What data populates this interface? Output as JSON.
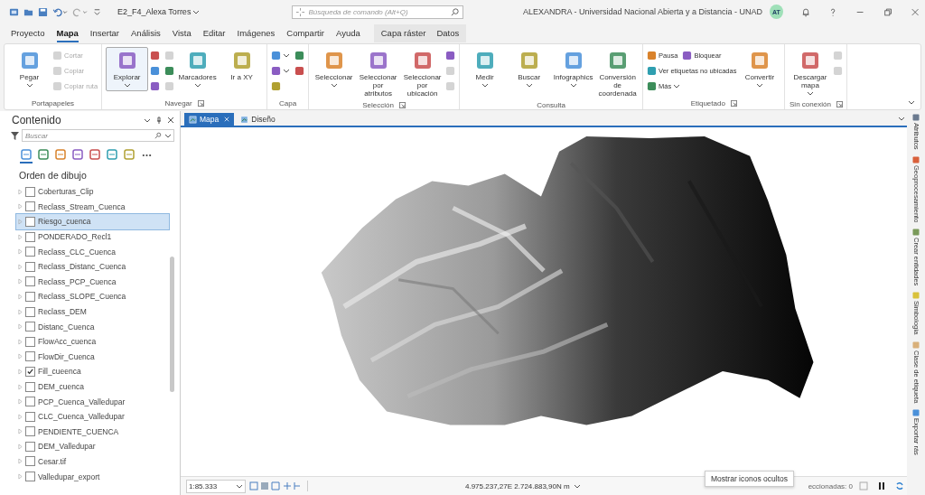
{
  "title_bar": {
    "project": "E2_F4_Alexa Torres",
    "search_placeholder": "Búsqueda de comando (Alt+Q)",
    "title": "ALEXANDRA - Universidad Nacional Abierta y a Distancia - UNAD",
    "avatar": "AT"
  },
  "menu_tabs": [
    {
      "label": "Proyecto",
      "selected": false
    },
    {
      "label": "Mapa",
      "selected": true
    },
    {
      "label": "Insertar",
      "selected": false
    },
    {
      "label": "Análisis",
      "selected": false
    },
    {
      "label": "Vista",
      "selected": false
    },
    {
      "label": "Editar",
      "selected": false
    },
    {
      "label": "Imágenes",
      "selected": false
    },
    {
      "label": "Compartir",
      "selected": false
    },
    {
      "label": "Ayuda",
      "selected": false
    }
  ],
  "contextual_tabs": [
    {
      "label": "Capa ráster",
      "selected": false
    },
    {
      "label": "Datos",
      "selected": false
    }
  ],
  "ribbon": {
    "groups": [
      {
        "label": "Portapapeles",
        "launcher": false,
        "items": [
          {
            "kind": "large",
            "label": "Pegar",
            "dropdown": true,
            "disabled": false,
            "selected": false
          },
          {
            "kind": "stack",
            "rows": [
              [
                {
                  "label": "Cortar",
                  "disabled": true,
                  "dropdown": false
                }
              ],
              [
                {
                  "label": "Copiar",
                  "disabled": true,
                  "dropdown": false
                }
              ],
              [
                {
                  "label": "Copiar ruta",
                  "disabled": true,
                  "dropdown": false
                }
              ]
            ]
          }
        ]
      },
      {
        "label": "Navegar",
        "launcher": true,
        "items": [
          {
            "kind": "large",
            "label": "Explorar",
            "dropdown": true,
            "disabled": false,
            "selected": true
          },
          {
            "kind": "stack",
            "rows": [
              [
                {
                  "disabled": false,
                  "dropdown": false
                },
                {
                  "disabled": true,
                  "dropdown": false
                }
              ],
              [
                {
                  "disabled": false,
                  "dropdown": false
                },
                {
                  "disabled": false,
                  "dropdown": false
                }
              ],
              [
                {
                  "disabled": false,
                  "dropdown": false
                },
                {
                  "disabled": true,
                  "dropdown": false
                }
              ]
            ]
          },
          {
            "kind": "large",
            "label": "Marcadores",
            "dropdown": true,
            "disabled": false,
            "selected": false
          },
          {
            "kind": "large",
            "label": "Ir a XY",
            "dropdown": false,
            "disabled": false,
            "selected": false
          }
        ]
      },
      {
        "label": "Capa",
        "launcher": false,
        "items": [
          {
            "kind": "stack",
            "rows": [
              [
                {
                  "disabled": false,
                  "dropdown": true
                },
                {
                  "disabled": false,
                  "dropdown": false
                }
              ],
              [
                {
                  "disabled": false,
                  "dropdown": true
                },
                {
                  "disabled": false,
                  "dropdown": false
                }
              ],
              [
                {
                  "disabled": false,
                  "dropdown": false
                }
              ]
            ]
          }
        ]
      },
      {
        "label": "Selección",
        "launcher": true,
        "items": [
          {
            "kind": "large",
            "label": "Seleccionar",
            "dropdown": true,
            "disabled": false,
            "selected": false
          },
          {
            "kind": "large",
            "label": "Seleccionar por atributos",
            "dropdown": false,
            "disabled": false,
            "selected": false
          },
          {
            "kind": "large",
            "label": "Seleccionar por ubicación",
            "dropdown": false,
            "disabled": false,
            "selected": false
          },
          {
            "kind": "stack",
            "rows": [
              [
                {
                  "disabled": false,
                  "dropdown": false
                }
              ],
              [
                {
                  "disabled": true,
                  "dropdown": false
                }
              ],
              [
                {
                  "disabled": true,
                  "dropdown": false
                }
              ]
            ]
          }
        ]
      },
      {
        "label": "Consulta",
        "launcher": false,
        "items": [
          {
            "kind": "large",
            "label": "Medir",
            "dropdown": true,
            "disabled": false,
            "selected": false
          },
          {
            "kind": "large",
            "label": "Buscar",
            "dropdown": true,
            "disabled": false,
            "selected": false
          },
          {
            "kind": "large",
            "label": "Infographics",
            "dropdown": true,
            "disabled": false,
            "selected": false
          },
          {
            "kind": "large",
            "label": "Conversión de coordenada",
            "dropdown": false,
            "disabled": false,
            "selected": false
          }
        ]
      },
      {
        "label": "Etiquetado",
        "launcher": true,
        "items": [
          {
            "kind": "stack",
            "rows": [
              [
                {
                  "label": "Pausa",
                  "disabled": false,
                  "dropdown": false
                },
                {
                  "label": "Bloquear",
                  "disabled": false,
                  "dropdown": false
                }
              ],
              [
                {
                  "label": "Ver etiquetas no ubicadas",
                  "disabled": false,
                  "dropdown": false
                }
              ],
              [
                {
                  "label": "Más",
                  "disabled": false,
                  "dropdown": true
                }
              ]
            ]
          },
          {
            "kind": "large",
            "label": "Convertir",
            "dropdown": true,
            "disabled": false,
            "selected": false
          }
        ]
      },
      {
        "label": "Sin conexión",
        "launcher": true,
        "items": [
          {
            "kind": "large",
            "label": "Descargar mapa",
            "dropdown": true,
            "disabled": false,
            "selected": false
          },
          {
            "kind": "stack",
            "rows": [
              [
                {
                  "disabled": true,
                  "dropdown": false
                }
              ],
              [
                {
                  "disabled": true,
                  "dropdown": false
                }
              ]
            ]
          }
        ]
      }
    ]
  },
  "contents": {
    "title": "Contenido",
    "search_placeholder": "Buscar",
    "view_tabs": [
      {
        "selected": true
      },
      {
        "selected": false
      },
      {
        "selected": false
      },
      {
        "selected": false
      },
      {
        "selected": false
      },
      {
        "selected": false
      },
      {
        "selected": false
      }
    ],
    "heading": "Orden de dibujo",
    "layers": [
      {
        "name": "Coberturas_Clip",
        "checked": false,
        "selected": false
      },
      {
        "name": "Reclass_Stream_Cuenca",
        "checked": false,
        "selected": false
      },
      {
        "name": "Riesgo_cuenca",
        "checked": false,
        "selected": true
      },
      {
        "name": "PONDERADO_Recl1",
        "checked": false,
        "selected": false
      },
      {
        "name": "Reclass_CLC_Cuenca",
        "checked": false,
        "selected": false
      },
      {
        "name": "Reclass_Distanc_Cuenca",
        "checked": false,
        "selected": false
      },
      {
        "name": "Reclass_PCP_Cuenca",
        "checked": false,
        "selected": false
      },
      {
        "name": "Reclass_SLOPE_Cuenca",
        "checked": false,
        "selected": false
      },
      {
        "name": "Reclass_DEM",
        "checked": false,
        "selected": false
      },
      {
        "name": "Distanc_Cuenca",
        "checked": false,
        "selected": false
      },
      {
        "name": "FlowAcc_cuenca",
        "checked": false,
        "selected": false
      },
      {
        "name": "FlowDir_Cuenca",
        "checked": false,
        "selected": false
      },
      {
        "name": "Fill_cueenca",
        "checked": true,
        "selected": false
      },
      {
        "name": "DEM_cuenca",
        "checked": false,
        "selected": false
      },
      {
        "name": "PCP_Cuenca_Valledupar",
        "checked": false,
        "selected": false
      },
      {
        "name": "CLC_Cuenca_Valledupar",
        "checked": false,
        "selected": false
      },
      {
        "name": "PENDIENTE_CUENCA",
        "checked": false,
        "selected": false
      },
      {
        "name": "DEM_Valledupar",
        "checked": false,
        "selected": false
      },
      {
        "name": "Cesar.tif",
        "checked": false,
        "selected": false
      },
      {
        "name": "Valledupar_export",
        "checked": false,
        "selected": false
      }
    ]
  },
  "view_tabs": [
    {
      "label": "Mapa",
      "selected": true,
      "closable": true
    },
    {
      "label": "Diseño",
      "selected": false,
      "closable": false
    }
  ],
  "status_bar": {
    "scale": "1:85.333",
    "coordinates": "4.975.237,27E 2.724.883,90N m",
    "selected_count": "eccionadas: 0",
    "tooltip": "Mostrar iconos ocultos"
  },
  "side_panes": [
    {
      "label": "Atributos"
    },
    {
      "label": "Geoprocesamiento"
    },
    {
      "label": "Crear entidades"
    },
    {
      "label": "Simbología"
    },
    {
      "label": "Clase de etiqueta"
    },
    {
      "label": "Exportar rás"
    }
  ]
}
